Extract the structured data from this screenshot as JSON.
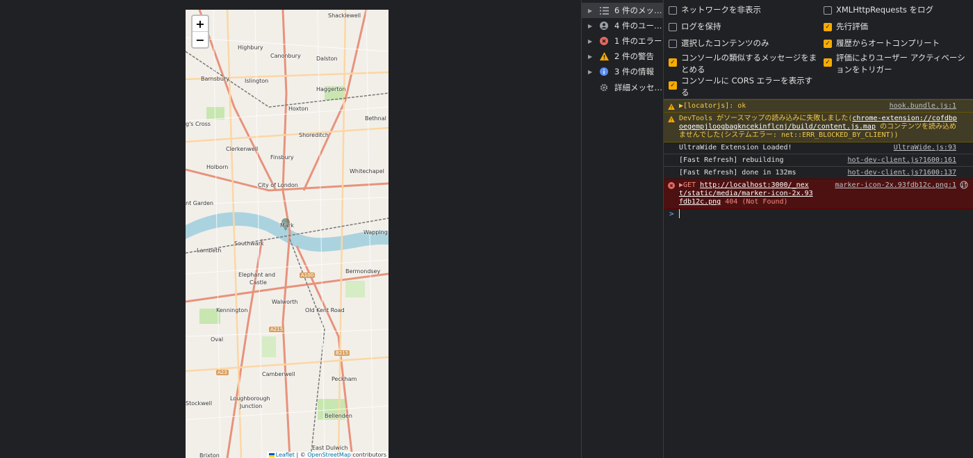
{
  "map": {
    "zoom_in": "+",
    "zoom_out": "−",
    "labels": [
      "Shacklewell",
      "Highbury",
      "Canonbury",
      "Dalston",
      "Barnsbury",
      "Islington",
      "Haggerton",
      "Hoxton",
      "Bethnal G",
      "g's Cross",
      "Shoreditch",
      "Clerkenwell",
      "Finsbury",
      "Holborn",
      "Whitechapel",
      "City of London",
      "nt Garden",
      "Wapping",
      "Lambeth",
      "Southwark",
      "Bermondsey",
      "Elephant and",
      "Castle",
      "Kennington",
      "Walworth",
      "Old Kent Road",
      "Oval",
      "Camberwell",
      "Peckham",
      "Stockwell",
      "Loughborough",
      "Junction",
      "Bellenden",
      "East Dulwich",
      "Brixton"
    ],
    "roads": [
      "A100",
      "A215",
      "B215",
      "A23"
    ],
    "marker_label": "Mark",
    "attribution": {
      "leaflet": "Leaflet",
      "sep": " | © ",
      "osm": "OpenStreetMap",
      "suffix": " contributors"
    }
  },
  "devtools": {
    "sidebar": [
      {
        "label": "6 件のメッ…",
        "icon": "list-icon"
      },
      {
        "label": "4 件のユー…",
        "icon": "user-icon"
      },
      {
        "label": "1 件のエラー",
        "icon": "error-icon"
      },
      {
        "label": "2 件の警告",
        "icon": "warning-icon"
      },
      {
        "label": "3 件の情報",
        "icon": "info-icon"
      },
      {
        "label": "詳細メッセ…",
        "icon": "gear-icon"
      }
    ],
    "settings": [
      {
        "label": "ネットワークを非表示",
        "checked": false
      },
      {
        "label": "XMLHttpRequests をログ",
        "checked": false
      },
      {
        "label": "ログを保持",
        "checked": false
      },
      {
        "label": "先行評価",
        "checked": true
      },
      {
        "label": "選択したコンテンツのみ",
        "checked": false
      },
      {
        "label": "履歴からオートコンプリート",
        "checked": true
      },
      {
        "label": "コンソールの類似するメッセージをまとめる",
        "checked": true
      },
      {
        "label": "評価によりユーザー アクティベーションをトリガー",
        "checked": true
      },
      {
        "label": "コンソールに CORS エラーを表示する",
        "checked": true
      }
    ],
    "console": {
      "m1": {
        "text": "▶[locatorjs]: ok",
        "src": "hook.bundle.js:1"
      },
      "m2": {
        "pre": "DevTools がソースマップの読み込みに失敗しました(",
        "link": "chrome-extension://cofdbpoegempjloogbagkncekinflcnj/build/content.js.map",
        "post": " のコンテンツを読み込めませんでした(システムエラー: net::ERR_BLOCKED_BY_CLIENT))"
      },
      "m3": {
        "text": "UltraWide Extension Loaded!",
        "src": "UltraWide.js:93"
      },
      "m4": {
        "text": "[Fast Refresh] rebuilding",
        "src": "hot-dev-client.js?1600:161"
      },
      "m5": {
        "text": "[Fast Refresh] done in 132ms",
        "src": "hot-dev-client.js?1600:137"
      },
      "m6": {
        "method": "▶GET ",
        "url": "http://localhost:3000/_next/static/media/marker-icon-2x.93fdb12c.png",
        "status": " 404 (Not Found)",
        "src": "marker-icon-2x.93fdb12c.png:1"
      },
      "prompt": ">"
    }
  }
}
